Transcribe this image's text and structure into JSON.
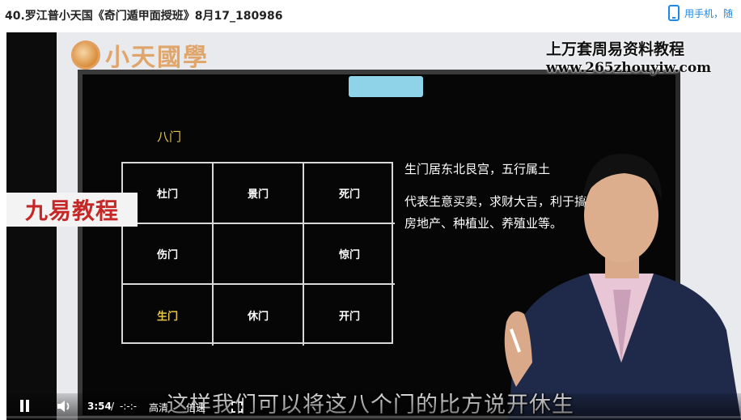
{
  "page": {
    "title": "40.罗江普小天国《奇门遁甲面授班》8月17_180986",
    "phone_link": "用手机，随"
  },
  "video": {
    "logo_text": "小天國學",
    "watermark_line1": "上万套周易资料教程",
    "watermark_line2": "www.265zhouyiw.com",
    "brand_stamp": "九易教程",
    "board": {
      "heading": "八门",
      "grid": [
        [
          {
            "label": "杜门"
          },
          {
            "label": "景门"
          },
          {
            "label": "死门"
          }
        ],
        [
          {
            "label": "伤门"
          },
          {
            "label": ""
          },
          {
            "label": "惊门"
          }
        ],
        [
          {
            "label": "生门"
          },
          {
            "label": "休门"
          },
          {
            "label": "开门"
          }
        ]
      ],
      "description": [
        "生门居东北艮宫，五行属土",
        "代表生意买卖，求财大吉，利于搞房地产、种植业、养殖业等。"
      ]
    },
    "subtitle": "这样我们可以将这八个门的比方说开休生"
  },
  "controls": {
    "current_time": "3:54",
    "separator": "/",
    "duration": "-:-:-",
    "quality_label": "高清",
    "speed_label": "倍速",
    "progress": 0.0
  },
  "colors": {
    "gold": "#e6c649",
    "link_blue": "#1e88e5",
    "stamp_red": "#c62828",
    "board_bg": "#060606"
  },
  "icons": [
    "phone-icon",
    "play-pause-icon",
    "volume-icon",
    "fullscreen-icon",
    "logo-icon"
  ]
}
